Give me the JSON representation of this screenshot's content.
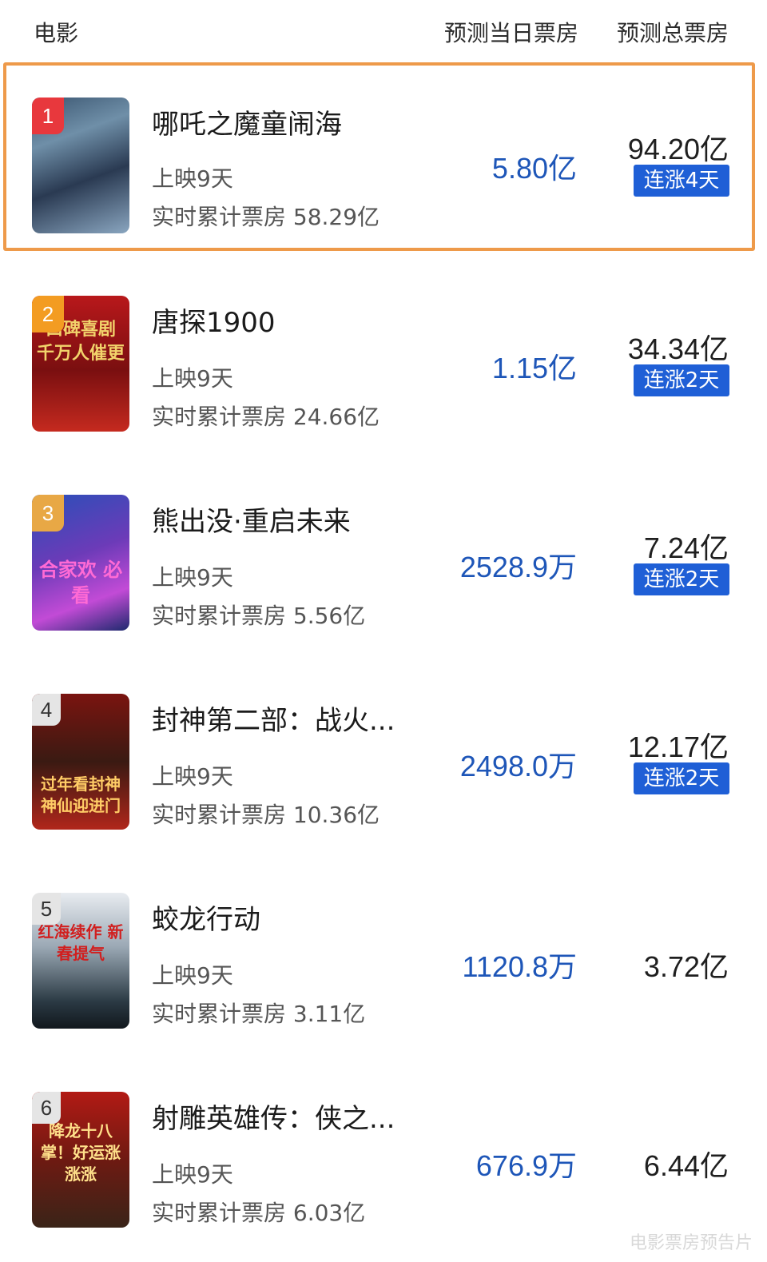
{
  "header": {
    "movie_col": "电影",
    "daily_col": "预测当日票房",
    "total_col": "预测总票房"
  },
  "movies": [
    {
      "rank": "1",
      "title": "哪吒之魔童闹海",
      "days": "上映9天",
      "cumulative": "实时累计票房 58.29亿",
      "daily": "5.80亿",
      "total": "94.20亿",
      "badge": "连涨4天",
      "rank_color": "#e8383d"
    },
    {
      "rank": "2",
      "title": "唐探1900",
      "days": "上映9天",
      "cumulative": "实时累计票房 24.66亿",
      "daily": "1.15亿",
      "total": "34.34亿",
      "badge": "连涨2天",
      "rank_color": "#f39c22"
    },
    {
      "rank": "3",
      "title": "熊出没·重启未来",
      "days": "上映9天",
      "cumulative": "实时累计票房 5.56亿",
      "daily": "2528.9万",
      "total": "7.24亿",
      "badge": "连涨2天",
      "rank_color": "#e8a845"
    },
    {
      "rank": "4",
      "title": "封神第二部：战火...",
      "days": "上映9天",
      "cumulative": "实时累计票房 10.36亿",
      "daily": "2498.0万",
      "total": "12.17亿",
      "badge": "连涨2天",
      "rank_color": "#e5e5e5"
    },
    {
      "rank": "5",
      "title": "蛟龙行动",
      "days": "上映9天",
      "cumulative": "实时累计票房 3.11亿",
      "daily": "1120.8万",
      "total": "3.72亿",
      "badge": "",
      "rank_color": "#e5e5e5"
    },
    {
      "rank": "6",
      "title": "射雕英雄传：侠之...",
      "days": "上映9天",
      "cumulative": "实时累计票房 6.03亿",
      "daily": "676.9万",
      "total": "6.44亿",
      "badge": "",
      "rank_color": "#e5e5e5"
    }
  ],
  "posters": [
    {
      "caption": "",
      "bg": "linear-gradient(160deg,#3a5570 0%,#6f8fa8 30%,#2a3a52 60%,#8aa6c0 100%)",
      "accent": "#d04a3a"
    },
    {
      "caption": "口碑喜剧 千万人催更",
      "bg": "linear-gradient(180deg,#b8181b 0%,#7a0f10 55%,#c52a1f 100%)",
      "accent": "#f2d36b"
    },
    {
      "caption": "合家欢 必看",
      "bg": "linear-gradient(160deg,#2a4fb8 0%,#6c3bb8 45%,#c24bd6 75%,#1e2a6e 100%)",
      "accent": "#ff6ad5"
    },
    {
      "caption": "过年看封神 神仙迎进门",
      "bg": "linear-gradient(180deg,#7a1410 0%,#3a1a12 50%,#b0261b 100%)",
      "accent": "#ffcc66"
    },
    {
      "caption": "红海续作 新春提气",
      "bg": "linear-gradient(180deg,#e8ecf0 0%,#9aa8b4 40%,#2b3a44 80%,#11181d 100%)",
      "accent": "#d11f1f"
    },
    {
      "caption": "降龙十八掌！好运涨涨涨",
      "bg": "linear-gradient(180deg,#b21a14 0%,#6e1a12 50%,#3a2418 100%)",
      "accent": "#ffe08a"
    }
  ],
  "watermark": "电影票房预告片"
}
